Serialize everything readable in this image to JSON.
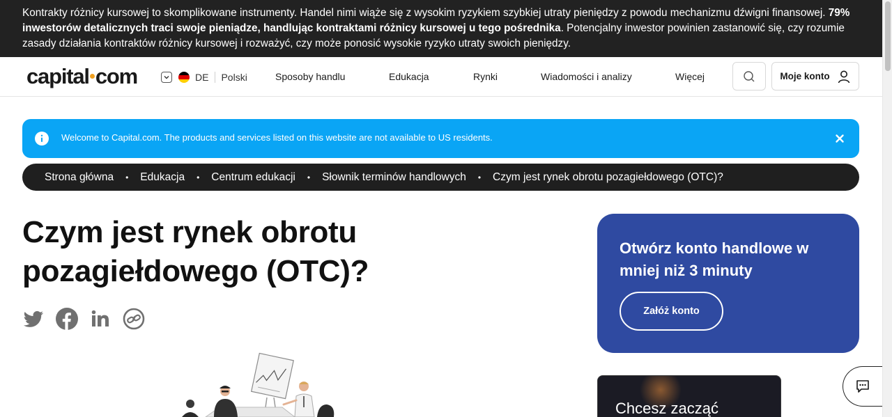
{
  "risk_banner": {
    "part1": "Kontrakty różnicy kursowej to skomplikowane instrumenty. Handel nimi wiąże się z wysokim ryzykiem szybkiej utraty pieniędzy z powodu mechanizmu dźwigni finansowej. ",
    "bold": "79% inwestorów detalicznych traci swoje pieniądze, handlując kontraktami różnicy kursowej u tego pośrednika",
    "part2": ". Potencjalny inwestor powinien zastanowić się, czy rozumie zasady działania kontraktów różnicy kursowej i rozważyć, czy może ponosić wysokie ryzyko utraty swoich pieniędzy."
  },
  "header": {
    "logo_left": "capital",
    "logo_right": "com",
    "region_code": "DE",
    "language": "Polski",
    "nav": [
      "Sposoby handlu",
      "Edukacja",
      "Rynki",
      "Wiadomości i analizy",
      "Więcej"
    ],
    "account_label": "Moje konto"
  },
  "info_bar": {
    "text": "Welcome to Capital.com. The products and services listed on this website are not available to US residents."
  },
  "breadcrumb": [
    "Strona główna",
    "Edukacja",
    "Centrum edukacji",
    "Słownik terminów handlowych",
    "Czym jest rynek obrotu pozagiełdowego (OTC)?"
  ],
  "article": {
    "title": "Czym jest rynek obrotu pozagiełdowego (OTC)?"
  },
  "cta": {
    "heading": "Otwórz konto handlowe w mniej niż 3 minuty",
    "button": "Załóż konto"
  },
  "promo": {
    "text": "Chcesz zacząć"
  },
  "colors": {
    "banner_bg": "#222222",
    "info_blue": "#0aa5f5",
    "cta_blue": "#2f4aa1",
    "logo_dot": "#f0a020"
  }
}
